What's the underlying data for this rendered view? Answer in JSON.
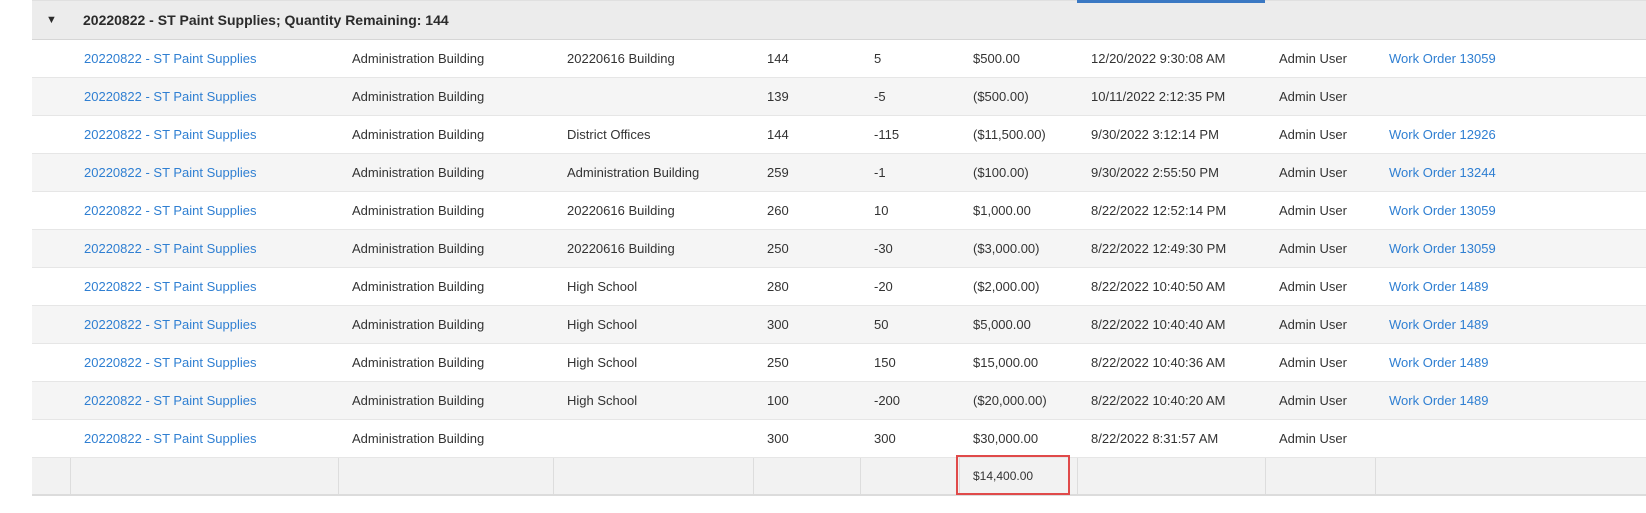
{
  "group": {
    "title": "20220822 - ST Paint Supplies; Quantity Remaining: 144",
    "toggle_icon": "caret-down-icon"
  },
  "rows": [
    {
      "item": "20220822 - ST Paint Supplies",
      "from": "Administration Building",
      "to": "20220616 Building",
      "qty": "144",
      "change": "5",
      "amount": "$500.00",
      "date": "12/20/2022 9:30:08 AM",
      "user": "Admin User",
      "work_order": "Work Order 13059"
    },
    {
      "item": "20220822 - ST Paint Supplies",
      "from": "Administration Building",
      "to": "",
      "qty": "139",
      "change": "-5",
      "amount": "($500.00)",
      "date": "10/11/2022 2:12:35 PM",
      "user": "Admin User",
      "work_order": ""
    },
    {
      "item": "20220822 - ST Paint Supplies",
      "from": "Administration Building",
      "to": "District Offices",
      "qty": "144",
      "change": "-115",
      "amount": "($11,500.00)",
      "date": "9/30/2022 3:12:14 PM",
      "user": "Admin User",
      "work_order": "Work Order 12926"
    },
    {
      "item": "20220822 - ST Paint Supplies",
      "from": "Administration Building",
      "to": "Administration Building",
      "qty": "259",
      "change": "-1",
      "amount": "($100.00)",
      "date": "9/30/2022 2:55:50 PM",
      "user": "Admin User",
      "work_order": "Work Order 13244"
    },
    {
      "item": "20220822 - ST Paint Supplies",
      "from": "Administration Building",
      "to": "20220616 Building",
      "qty": "260",
      "change": "10",
      "amount": "$1,000.00",
      "date": "8/22/2022 12:52:14 PM",
      "user": "Admin User",
      "work_order": "Work Order 13059"
    },
    {
      "item": "20220822 - ST Paint Supplies",
      "from": "Administration Building",
      "to": "20220616 Building",
      "qty": "250",
      "change": "-30",
      "amount": "($3,000.00)",
      "date": "8/22/2022 12:49:30 PM",
      "user": "Admin User",
      "work_order": "Work Order 13059"
    },
    {
      "item": "20220822 - ST Paint Supplies",
      "from": "Administration Building",
      "to": "High School",
      "qty": "280",
      "change": "-20",
      "amount": "($2,000.00)",
      "date": "8/22/2022 10:40:50 AM",
      "user": "Admin User",
      "work_order": "Work Order 1489"
    },
    {
      "item": "20220822 - ST Paint Supplies",
      "from": "Administration Building",
      "to": "High School",
      "qty": "300",
      "change": "50",
      "amount": "$5,000.00",
      "date": "8/22/2022 10:40:40 AM",
      "user": "Admin User",
      "work_order": "Work Order 1489"
    },
    {
      "item": "20220822 - ST Paint Supplies",
      "from": "Administration Building",
      "to": "High School",
      "qty": "250",
      "change": "150",
      "amount": "$15,000.00",
      "date": "8/22/2022 10:40:36 AM",
      "user": "Admin User",
      "work_order": "Work Order 1489"
    },
    {
      "item": "20220822 - ST Paint Supplies",
      "from": "Administration Building",
      "to": "High School",
      "qty": "100",
      "change": "-200",
      "amount": "($20,000.00)",
      "date": "8/22/2022 10:40:20 AM",
      "user": "Admin User",
      "work_order": "Work Order 1489"
    },
    {
      "item": "20220822 - ST Paint Supplies",
      "from": "Administration Building",
      "to": "",
      "qty": "300",
      "change": "300",
      "amount": "$30,000.00",
      "date": "8/22/2022 8:31:57 AM",
      "user": "Admin User",
      "work_order": ""
    }
  ],
  "footer": {
    "total_amount": "$14,400.00"
  },
  "colors": {
    "link": "#2f7fd2",
    "highlight_border": "#e04a4a",
    "header_accent": "#3a78c3"
  }
}
